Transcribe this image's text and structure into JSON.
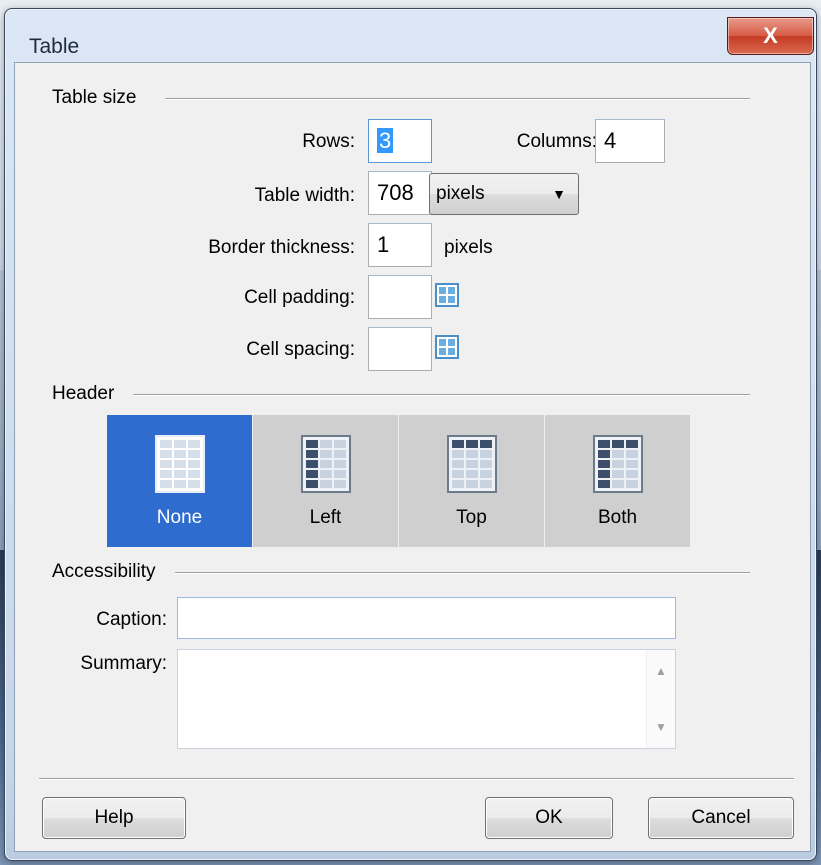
{
  "window": {
    "title": "Table",
    "close_glyph": "X"
  },
  "table_size": {
    "section_label": "Table size",
    "rows_label": "Rows:",
    "rows_value": "3",
    "columns_label": "Columns:",
    "columns_value": "4",
    "width_label": "Table width:",
    "width_value": "708",
    "width_unit": "pixels",
    "width_unit_arrow": "▼",
    "border_label": "Border thickness:",
    "border_value": "1",
    "border_unit": "pixels",
    "padding_label": "Cell padding:",
    "padding_value": "",
    "spacing_label": "Cell spacing:",
    "spacing_value": ""
  },
  "header": {
    "section_label": "Header",
    "options": [
      {
        "label": "None",
        "selected": true
      },
      {
        "label": "Left",
        "selected": false
      },
      {
        "label": "Top",
        "selected": false
      },
      {
        "label": "Both",
        "selected": false
      }
    ]
  },
  "accessibility": {
    "section_label": "Accessibility",
    "caption_label": "Caption:",
    "caption_value": "",
    "summary_label": "Summary:",
    "summary_value": "",
    "scroll_up": "▲",
    "scroll_down": "▼"
  },
  "buttons": {
    "help": "Help",
    "ok": "OK",
    "cancel": "Cancel"
  },
  "colors": {
    "selected_header": "#2f6ccf",
    "unselected_header": "#cfcfcf",
    "close_button": "#c43b23"
  }
}
